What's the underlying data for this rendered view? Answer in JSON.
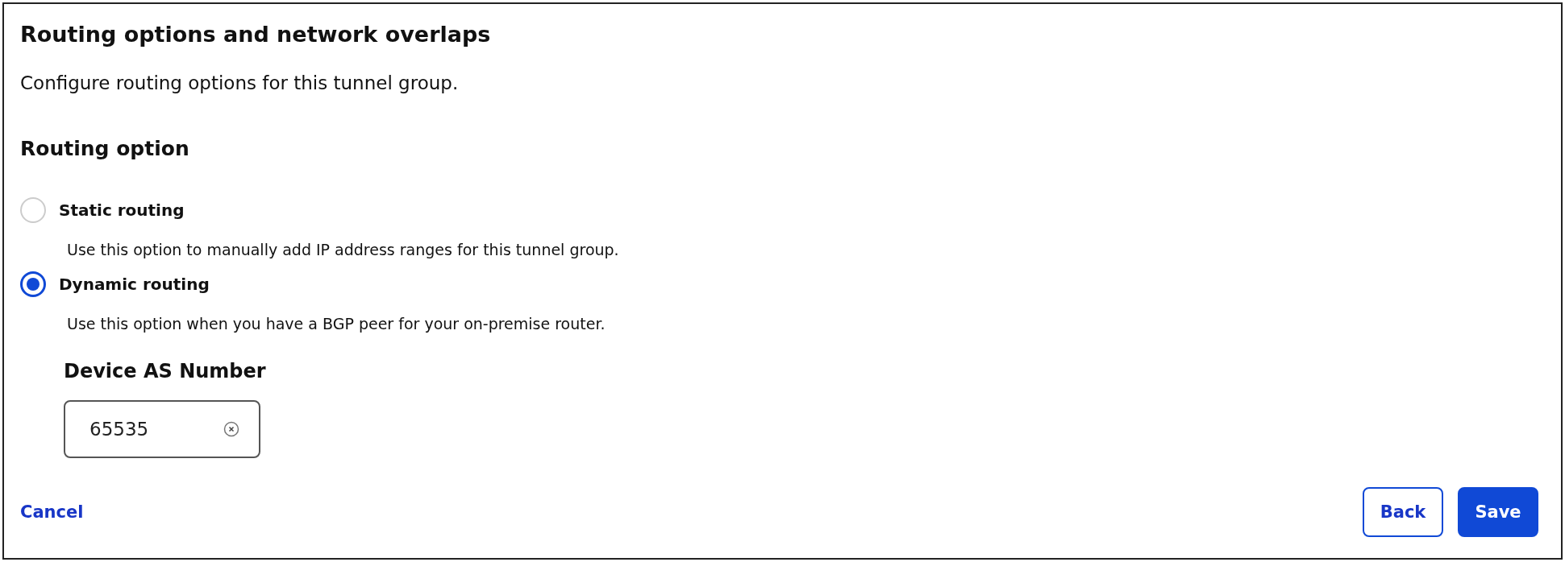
{
  "title": "Routing options and network overlaps",
  "subtitle": "Configure routing options for this tunnel group.",
  "section": {
    "title": "Routing option",
    "options": [
      {
        "label": "Static routing",
        "description": "Use this option to manually add IP address ranges for this tunnel group.",
        "selected": false
      },
      {
        "label": "Dynamic routing",
        "description": "Use this option when you have a BGP peer for your on-premise router.",
        "selected": true
      }
    ]
  },
  "field": {
    "label": "Device AS Number",
    "value": "65535"
  },
  "footer": {
    "link": "Cancel",
    "buttons": [
      {
        "label": "Back",
        "kind": "secondary"
      },
      {
        "label": "Save",
        "kind": "primary"
      }
    ]
  }
}
